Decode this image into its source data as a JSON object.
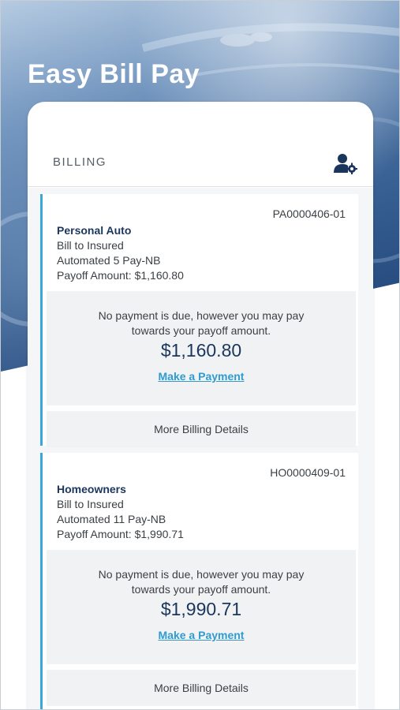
{
  "header": {
    "title": "Easy Bill Pay"
  },
  "billing": {
    "section_label": "BILLING",
    "settings_icon": "user-settings-icon"
  },
  "policies": [
    {
      "policy_number": "PA0000406-01",
      "type": "Personal Auto",
      "bill_to": "Bill to Insured",
      "plan": "Automated 5 Pay-NB",
      "payoff_line": "Payoff Amount: $1,160.80",
      "message_line1": "No payment is due, however you may pay",
      "message_line2": "towards your payoff amount.",
      "amount": "$1,160.80",
      "pay_link": "Make a Payment",
      "details_button": "More Billing Details"
    },
    {
      "policy_number": "HO0000409-01",
      "type": "Homeowners",
      "bill_to": "Bill to Insured",
      "plan": "Automated 11 Pay-NB",
      "payoff_line": "Payoff Amount: $1,990.71",
      "message_line1": "No payment is due, however you may pay",
      "message_line2": "towards your payoff amount.",
      "amount": "$1,990.71",
      "pay_link": "Make a Payment",
      "details_button": "More Billing Details"
    }
  ],
  "colors": {
    "accent": "#3aa7d6",
    "link": "#2f9bd0",
    "navy": "#1b365d",
    "hero_dark": "#284e82"
  }
}
